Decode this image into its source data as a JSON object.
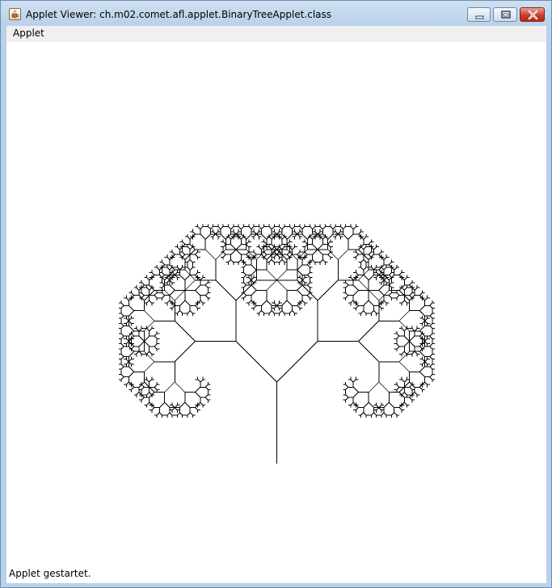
{
  "window": {
    "title": "Applet Viewer: ch.m02.comet.afl.applet.BinaryTreeApplet.class",
    "controls": {
      "minimize": "minimize-icon",
      "maximize": "maximize-icon",
      "close": "close-icon"
    }
  },
  "menubar": {
    "items": [
      {
        "label": "Applet"
      }
    ]
  },
  "applet": {
    "drawing": "binary-tree-fractal",
    "tree": {
      "depth": 11,
      "branch_angle_deg": 45,
      "length_ratio": 0.7071,
      "stroke_color": "#000000"
    }
  },
  "status": {
    "text": "Applet gestartet."
  },
  "colors": {
    "titlebar": "#b9d1ea",
    "close_button": "#c8402c",
    "menubar": "#f0f0f0",
    "canvas": "#ffffff"
  }
}
